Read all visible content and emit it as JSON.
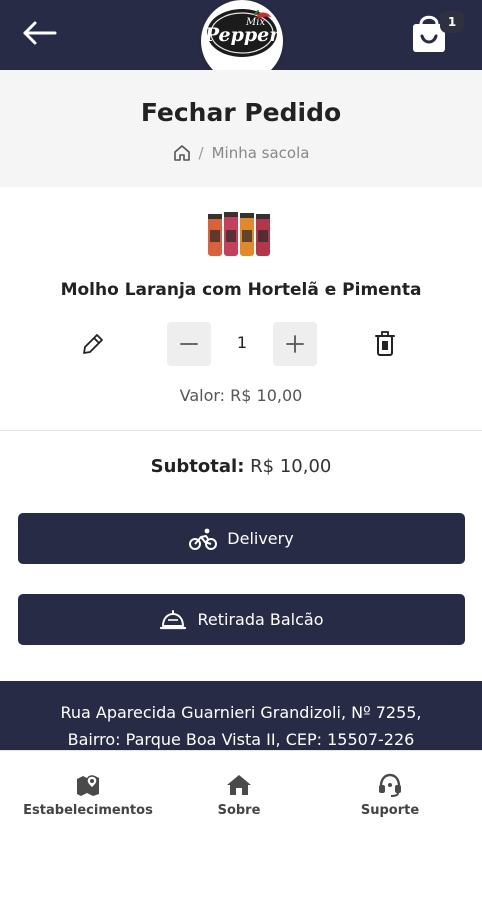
{
  "header": {
    "logo_text": "Mix Pepper",
    "cart_count": "1"
  },
  "page": {
    "title": "Fechar Pedido",
    "breadcrumb_current": "Minha sacola",
    "breadcrumb_separator": "/"
  },
  "product": {
    "name": "Molho Laranja com Hortelã e Pimenta",
    "quantity": "1",
    "price_label": "Valor:",
    "price_value": "R$ 10,00"
  },
  "summary": {
    "subtotal_label": "Subtotal:",
    "subtotal_value": "R$ 10,00"
  },
  "actions": {
    "delivery_label": "Delivery",
    "pickup_label": "Retirada Balcão"
  },
  "footer": {
    "address_line1": "Rua Aparecida Guarnieri Grandizoli, Nº 7255,",
    "address_line2": "Bairro: Parque Boa Vista II, CEP: 15507-226"
  },
  "nav": {
    "items": [
      {
        "label": "Estabelecimentos",
        "icon": "map-icon"
      },
      {
        "label": "Sobre",
        "icon": "home-icon"
      },
      {
        "label": "Suporte",
        "icon": "headset-icon"
      }
    ]
  },
  "colors": {
    "primary": "#282b45",
    "header_bg": "#f5f5f5",
    "qty_button_bg": "#eeeeee"
  }
}
